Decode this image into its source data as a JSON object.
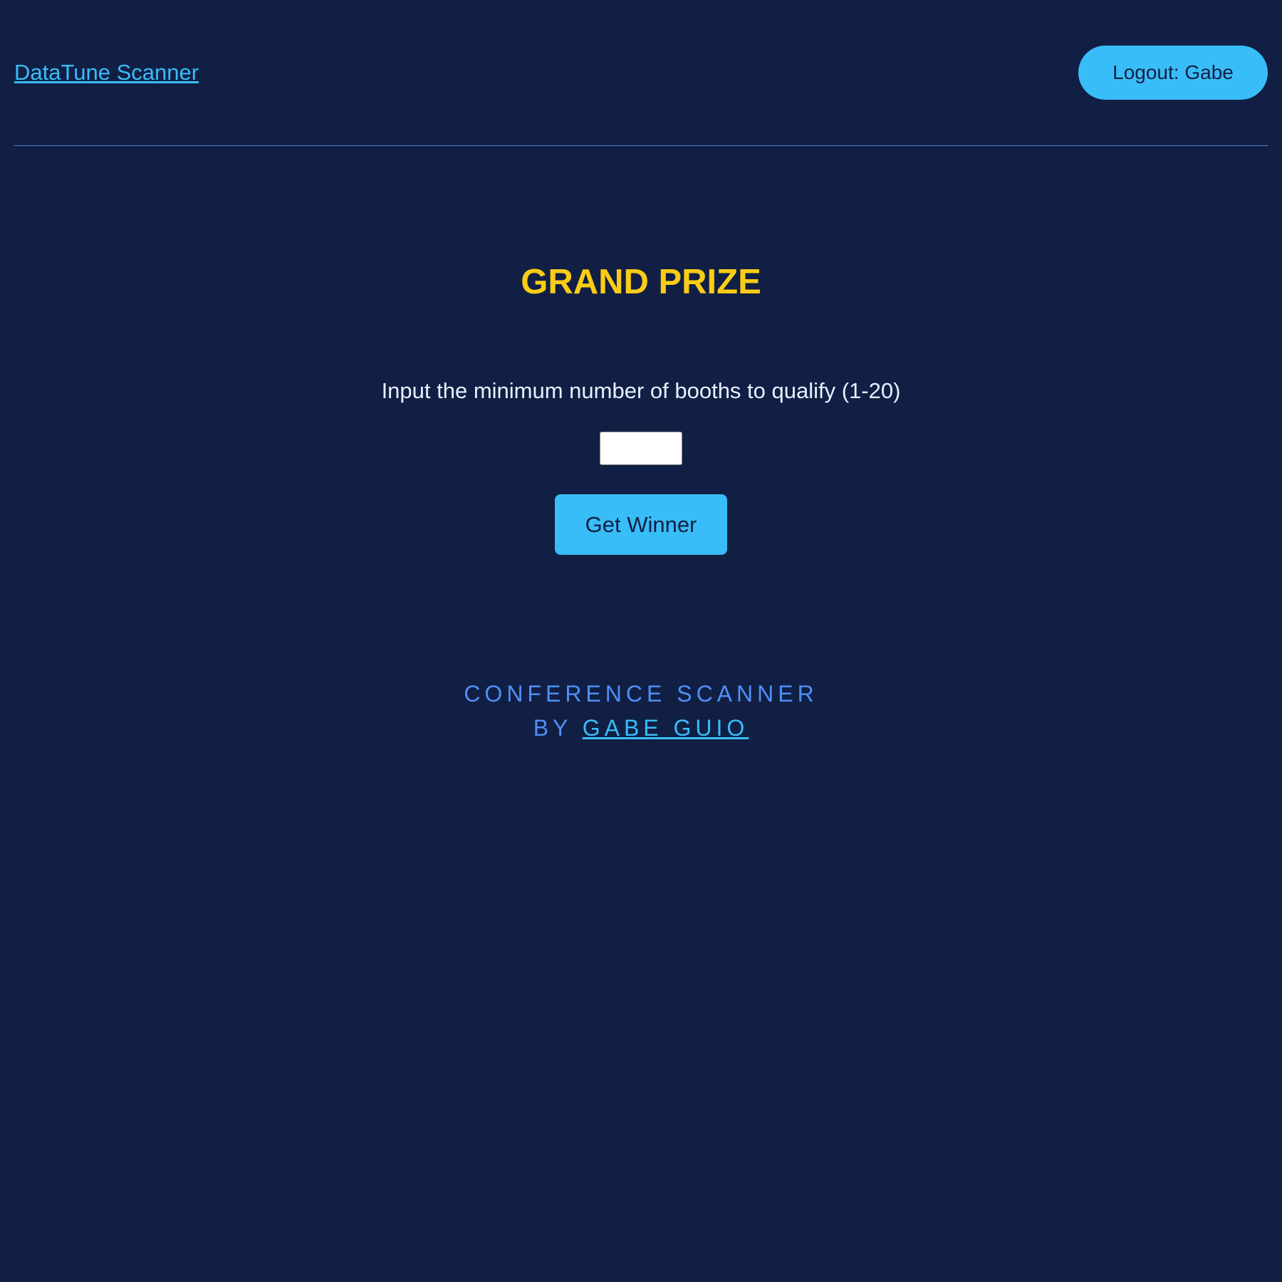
{
  "header": {
    "brand": "DataTune Scanner",
    "logout_label": "Logout: Gabe"
  },
  "main": {
    "title": "GRAND PRIZE",
    "prompt": "Input the minimum number of booths to qualify (1-20)",
    "booths_input": {
      "value": "",
      "placeholder": ""
    },
    "get_winner_label": "Get Winner"
  },
  "footer": {
    "line1": "CONFERENCE SCANNER",
    "by_prefix": "BY ",
    "author": "GABE GUIO"
  },
  "colors": {
    "background": "#111f44",
    "accent": "#38bdf8",
    "title": "#facc15",
    "footer_text": "#4f8ff7",
    "divider": "#4b83d6"
  }
}
